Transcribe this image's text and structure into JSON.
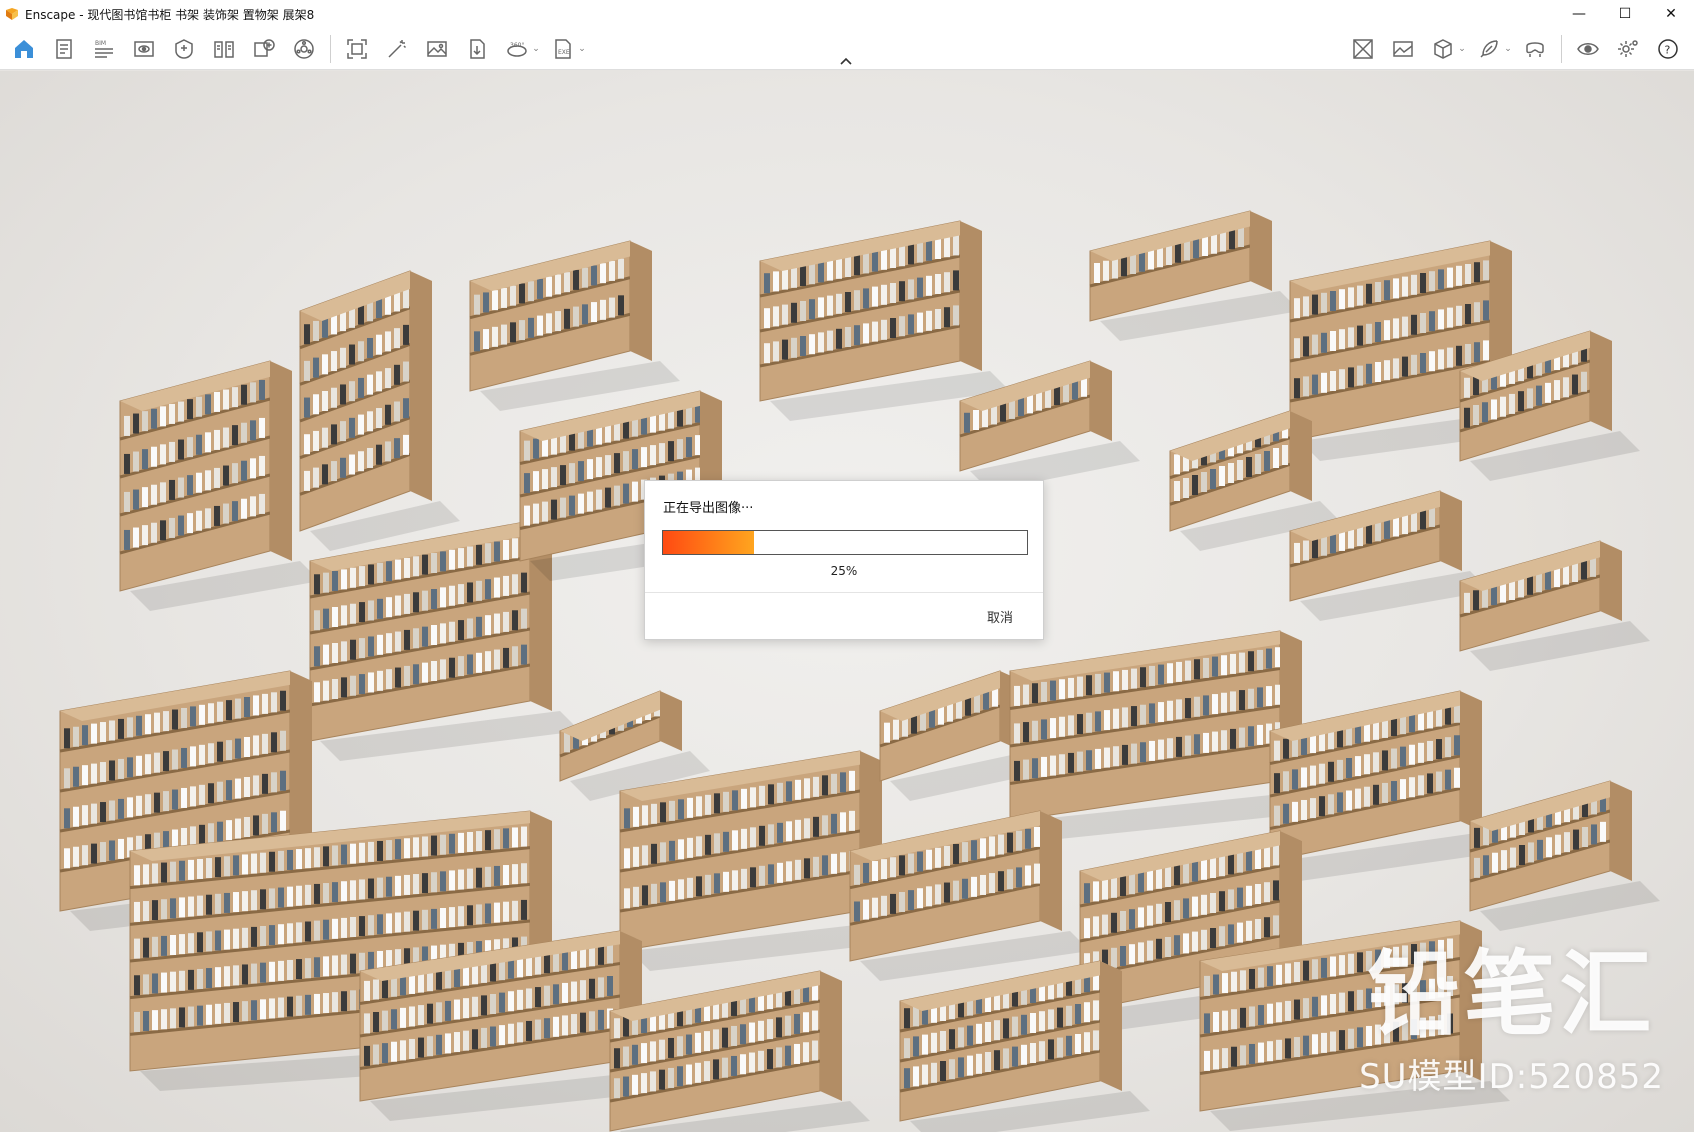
{
  "window": {
    "app_name": "Enscape",
    "title": "Enscape - 现代图书馆书柜 书架 装饰架 置物架 展架8",
    "controls": {
      "minimize": "—",
      "maximize": "☐",
      "close": "✕"
    }
  },
  "toolbar": {
    "left_icons": [
      "home-icon",
      "notes-icon",
      "bim-icon",
      "view-icon",
      "asset-library-icon",
      "book-icon",
      "add-view-icon",
      "panorama-icon",
      "screenshot-icon",
      "magic-wand-icon",
      "image-icon",
      "batch-render-icon",
      "360-icon",
      "exe-export-icon"
    ],
    "right_icons": [
      "material-editor-icon",
      "gallery-icon",
      "cube-icon",
      "feather-icon",
      "vr-headset-icon",
      "eye-icon",
      "settings-icon",
      "help-icon"
    ],
    "bim_label": "BIM",
    "pano_label": "360°",
    "exe_label": "EXE",
    "help_label": "?"
  },
  "branding": {
    "name": "铅笔汇",
    "model_id": "SU模型ID:520852"
  },
  "dialog": {
    "message": "正在导出图像···",
    "progress_percent": 25,
    "progress_label": "25%",
    "cancel_label": "取消"
  },
  "colors": {
    "accent": "#3b8fd8",
    "progress_start": "#ff4a12",
    "progress_end": "#ffa51f",
    "wood": "#c9a57d"
  }
}
